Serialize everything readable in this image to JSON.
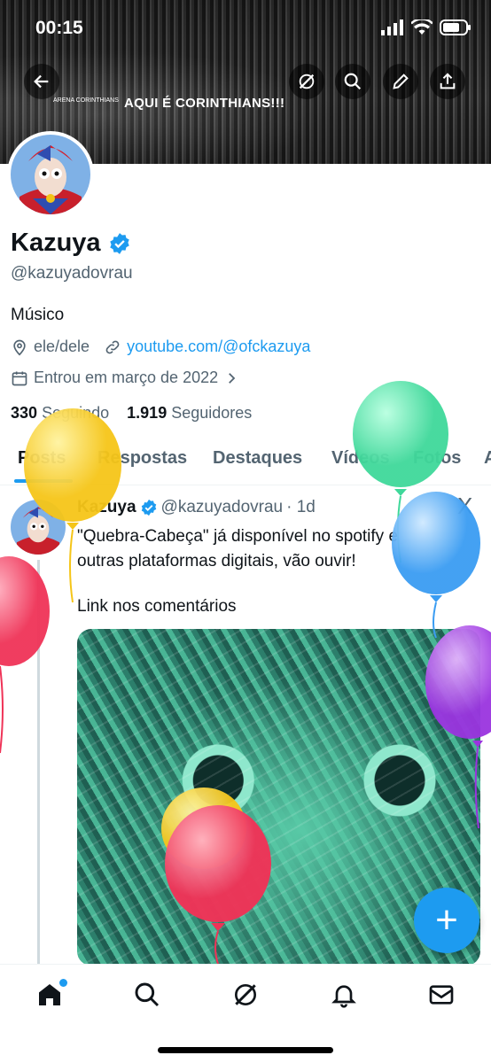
{
  "status_bar": {
    "time": "00:15"
  },
  "banner": {
    "title": "AQUI É CORINTHIANS!!!",
    "stadium_label": "ARENA CORINTHIANS"
  },
  "profile": {
    "name": "Kazuya",
    "handle": "@kazuyadovrau",
    "bio": "Músico",
    "location": "ele/dele",
    "website": "youtube.com/@ofckazuya",
    "joined": "Entrou em março de 2022",
    "following_count": "330",
    "following_label": "Seguindo",
    "followers_count": "1.919",
    "followers_label": "Seguidores",
    "verified_color": "#1d9bf0"
  },
  "tabs": [
    {
      "label": "Posts",
      "active": true
    },
    {
      "label": "Respostas"
    },
    {
      "label": "Destaques"
    },
    {
      "label": "Vídeos"
    },
    {
      "label": "Fotos"
    },
    {
      "label": "A"
    }
  ],
  "tweet": {
    "author": "Kazuya",
    "handle": "@kazuyadovrau",
    "time": "· 1d",
    "text": "\"Quebra-Cabeça\" já disponível no spotify e outras plataformas digitais, vão ouvir!",
    "text2": "Link nos comentários",
    "close": "X"
  },
  "fab": {
    "label": "+"
  },
  "icons": {
    "back": "arrow-left-icon",
    "grok": "grok-icon",
    "search": "search-icon",
    "edit": "pencil-icon",
    "share": "share-icon",
    "location": "location-pin-icon",
    "link": "link-icon",
    "calendar": "calendar-icon",
    "nav": [
      "home-icon",
      "search-icon",
      "grok-icon",
      "bell-icon",
      "mail-icon"
    ]
  },
  "colors": {
    "accent": "#1d9bf0",
    "text": "#0f1419",
    "secondary": "#536471"
  }
}
